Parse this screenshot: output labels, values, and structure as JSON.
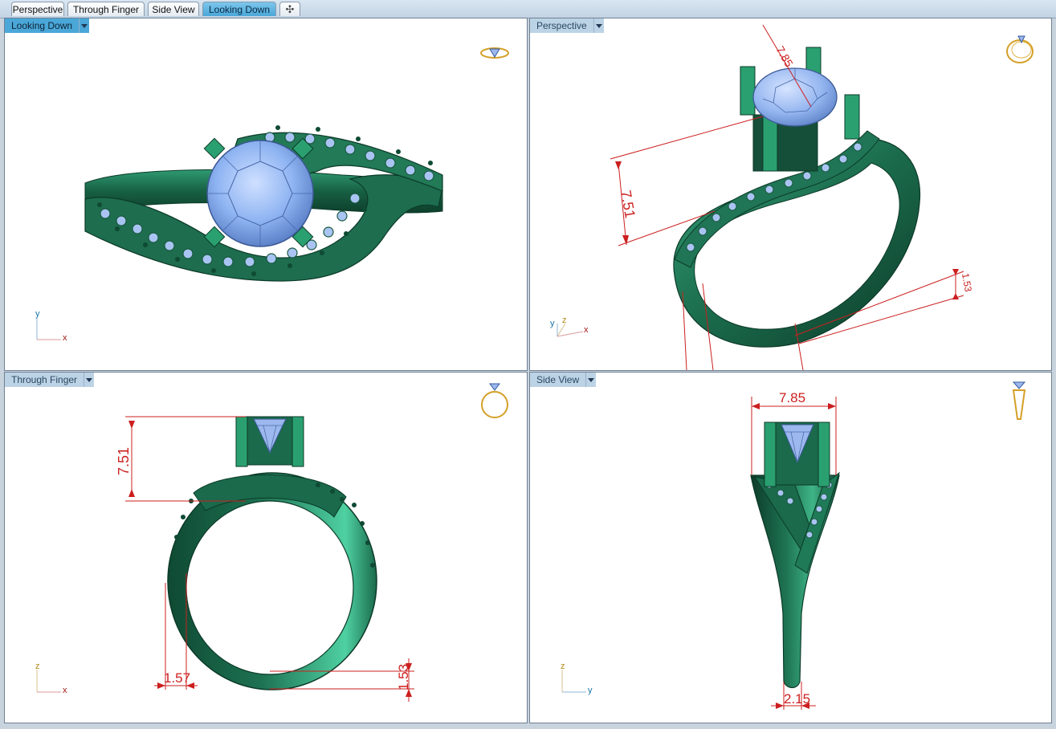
{
  "tabs": [
    {
      "label": "Perspective",
      "active": false
    },
    {
      "label": "Through Finger",
      "active": false
    },
    {
      "label": "Side View",
      "active": false
    },
    {
      "label": "Looking Down",
      "active": true
    }
  ],
  "add_tab_symbol": "✣",
  "viewports": {
    "top_left": {
      "title": "Looking Down",
      "axis_a": "y",
      "axis_b": "x",
      "icon": "ring-top-icon"
    },
    "top_right": {
      "title": "Perspective",
      "axis_a": "y",
      "axis_b": "z",
      "axis_c": "x",
      "icon": "ring-perspective-icon",
      "dims": {
        "height": "7.51",
        "stone": "7.85",
        "band": "1.53"
      }
    },
    "bottom_left": {
      "title": "Through Finger",
      "axis_a": "z",
      "axis_b": "x",
      "icon": "ring-front-icon",
      "dims": {
        "height": "7.51",
        "width": "1.57",
        "band": "1.53"
      }
    },
    "bottom_right": {
      "title": "Side View",
      "axis_a": "z",
      "axis_b": "y",
      "icon": "ring-side-icon",
      "dims": {
        "stone": "7.85",
        "shank": "2.15"
      }
    }
  },
  "colors": {
    "metal": "#1c6e4f",
    "metal_light": "#34a07a",
    "stone": "#8fb4f2",
    "dimension": "#cc1f1f",
    "active_tab": "#4aa7d8"
  }
}
